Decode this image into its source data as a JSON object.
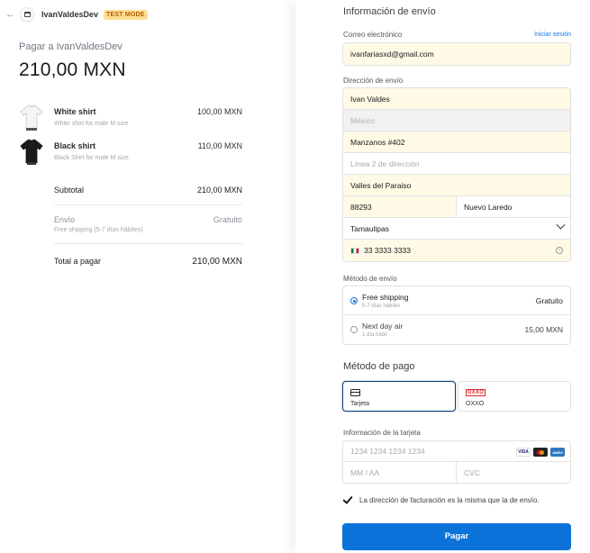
{
  "header": {
    "back_icon": "arrow-left-icon",
    "business_name": "IvanValdesDev",
    "mode_badge": "TEST MODE"
  },
  "summary": {
    "pay_to": "Pagar a IvanValdesDev",
    "total_amount": "210,00 MXN",
    "items": [
      {
        "name": "White shirt",
        "description": "White shirt for male M size",
        "price": "100,00 MXN",
        "image": "white-tshirt"
      },
      {
        "name": "Black shirt",
        "description": "Black Shirt for male M size",
        "price": "110,00 MXN",
        "image": "black-tshirt"
      }
    ],
    "subtotal_label": "Subtotal",
    "subtotal_value": "210,00 MXN",
    "shipping_label": "Envío",
    "shipping_desc": "Free shipping (5-7 días hábiles)",
    "shipping_value": "Gratuito",
    "total_label": "Total a pagar",
    "total_value": "210,00 MXN"
  },
  "shipping_info": {
    "title": "Información de envío",
    "email_label": "Correo electrónico",
    "login_link": "Iniciar sesión",
    "email_value": "ivanfariasxd@gmail.com",
    "address_label": "Dirección de envío",
    "name": "Ivan Valdes",
    "country_placeholder": "México",
    "line1": "Manzanos #402",
    "line2_placeholder": "Línea 2 de dirección",
    "neighborhood": "Valles del Paraiso",
    "postal_code": "88293",
    "city": "Nuevo Laredo",
    "state": "Tamaulipas",
    "phone": "33 3333 3333"
  },
  "shipping_method": {
    "label": "Método de envío",
    "options": [
      {
        "name": "Free shipping",
        "sub": "5-7 días hábiles",
        "price": "Gratuito",
        "selected": true
      },
      {
        "name": "Next day air",
        "sub": "1 día hábil",
        "price": "15,00 MXN",
        "selected": false
      }
    ]
  },
  "payment": {
    "title": "Método de pago",
    "card_tab": "Tarjeta",
    "oxxo_tab": "OXXO",
    "oxxo_logo": "OXXO",
    "card_info_label": "Información de la tarjeta",
    "card_number_placeholder": "1234 1234 1234 1234",
    "expiry_placeholder": "MM / AA",
    "cvc_placeholder": "CVC",
    "brands": [
      "VISA",
      "mastercard",
      "AMEX"
    ],
    "billing_same": "La dirección de facturación es la misma que la de envío.",
    "pay_button": "Pagar"
  },
  "colors": {
    "accent": "#0a72d8",
    "autofill": "#fefae6",
    "badge_bg": "#ffde92",
    "badge_text": "#b35e00"
  }
}
